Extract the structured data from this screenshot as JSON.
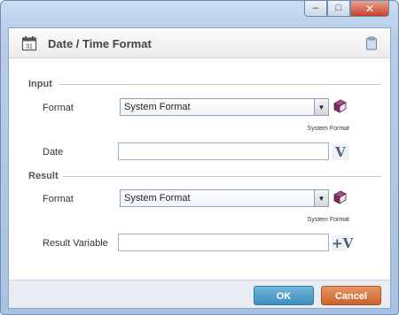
{
  "window": {
    "controls": {
      "minimize": "–",
      "maximize": "□",
      "close": "✕"
    }
  },
  "header": {
    "title": "Date / Time Format",
    "icon": "calendar-icon",
    "action_icon": "clipboard-icon"
  },
  "input_section": {
    "title": "Input",
    "format_label": "Format",
    "format_value": "System Format",
    "format_note": "System Format",
    "date_label": "Date",
    "date_value": ""
  },
  "result_section": {
    "title": "Result",
    "format_label": "Format",
    "format_value": "System Format",
    "format_note": "System Format",
    "variable_label": "Result Variable",
    "variable_value": ""
  },
  "icons": {
    "variable_glyph": "V",
    "add_variable_glyph": "+V"
  },
  "footer": {
    "ok_label": "OK",
    "cancel_label": "Cancel"
  },
  "colors": {
    "ok": "#4f9fcb",
    "cancel": "#d87540"
  }
}
